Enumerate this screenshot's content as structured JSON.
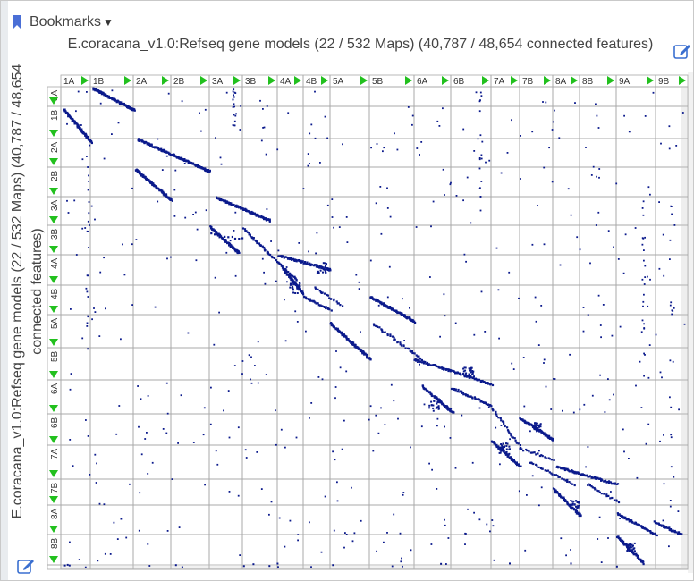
{
  "panel": {
    "bookmarks_label": "Bookmarks",
    "bookmark_icon_color": "#4a6fd6"
  },
  "plot": {
    "title_top": "E.coracana_v1.0:Refseq gene models (22 / 532 Maps) (40,787 / 48,654 connected features)",
    "title_left": "E.coracana_v1.0:Refseq gene models (22 / 532 Maps) (40,787 / 48,654 connected features)",
    "x_labels": [
      "1A",
      "1B",
      "2A",
      "2B",
      "3A",
      "3B",
      "4A",
      "4B",
      "5A",
      "5B",
      "6A",
      "6B",
      "7A",
      "7B",
      "8A",
      "8B",
      "9A",
      "9B"
    ],
    "y_labels": [
      "1A",
      "1B",
      "2A",
      "2B",
      "3A",
      "3B",
      "4A",
      "4B",
      "5A",
      "5B",
      "6A",
      "6B",
      "7A",
      "7B",
      "8A",
      "8B",
      "9A",
      "9B"
    ],
    "dot_color": "#0b1a8c",
    "arrow_color": "#22c01e",
    "grid_color": "#a9a9a9"
  },
  "icons": {
    "edit": "edit-pencil-icon",
    "bookmark": "bookmark-icon"
  }
}
